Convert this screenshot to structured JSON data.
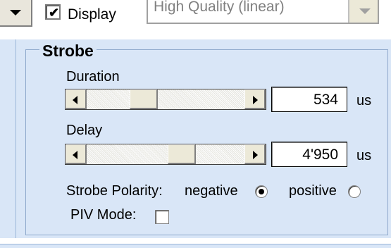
{
  "top": {
    "display_checked": true,
    "display_label": "Display",
    "quality_value": "High Quality (linear)"
  },
  "strobe": {
    "title": "Strobe",
    "duration": {
      "label": "Duration",
      "value": "534",
      "unit": "us",
      "slider_fraction": 0.33
    },
    "delay": {
      "label": "Delay",
      "value": "4'950",
      "unit": "us",
      "slider_fraction": 0.62
    },
    "polarity": {
      "label": "Strobe Polarity:",
      "options": [
        "negative",
        "positive"
      ],
      "selected": "negative"
    },
    "piv_mode": {
      "label": "PIV Mode:",
      "checked": false
    }
  },
  "colors": {
    "panel_bg": "#d9e6f7",
    "group_border": "#8ea8cc"
  }
}
